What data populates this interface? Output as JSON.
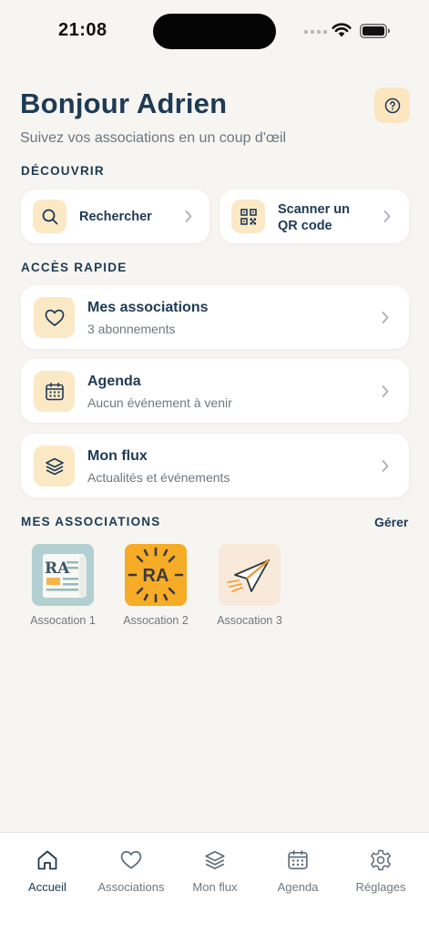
{
  "status_bar": {
    "time": "21:08"
  },
  "header": {
    "greeting": "Bonjour Adrien",
    "subtitle": "Suivez vos associations en un coup d'œil"
  },
  "discover": {
    "label": "DÉCOUVRIR",
    "search_label": "Rechercher",
    "scan_label_line1": "Scanner un",
    "scan_label_line2": "QR code"
  },
  "quick_access": {
    "label": "ACCÈS RAPIDE",
    "items": [
      {
        "title": "Mes associations",
        "subtitle": "3 abonnements",
        "icon": "heart-icon"
      },
      {
        "title": "Agenda",
        "subtitle": "Aucun événement à venir",
        "icon": "calendar-icon"
      },
      {
        "title": "Mon flux",
        "subtitle": "Actualités et événements",
        "icon": "layers-icon"
      }
    ]
  },
  "my_associations": {
    "label": "MES ASSOCIATIONS",
    "manage_label": "Gérer",
    "items": [
      {
        "name": "Assocation 1",
        "logo_text": "RA"
      },
      {
        "name": "Assocation 2",
        "logo_text": "RA"
      },
      {
        "name": "Assocation 3"
      }
    ]
  },
  "tab_bar": {
    "items": [
      {
        "label": "Accueil",
        "icon": "home-icon",
        "active": true
      },
      {
        "label": "Associations",
        "icon": "heart-icon"
      },
      {
        "label": "Mon flux",
        "icon": "layers-icon"
      },
      {
        "label": "Agenda",
        "icon": "calendar-icon"
      },
      {
        "label": "Réglages",
        "icon": "gear-icon"
      }
    ]
  },
  "colors": {
    "background": "#f7f5f1",
    "primary_text": "#1e3a55",
    "icon_tile": "#fbe9c6",
    "accent_orange": "#f5a623"
  }
}
